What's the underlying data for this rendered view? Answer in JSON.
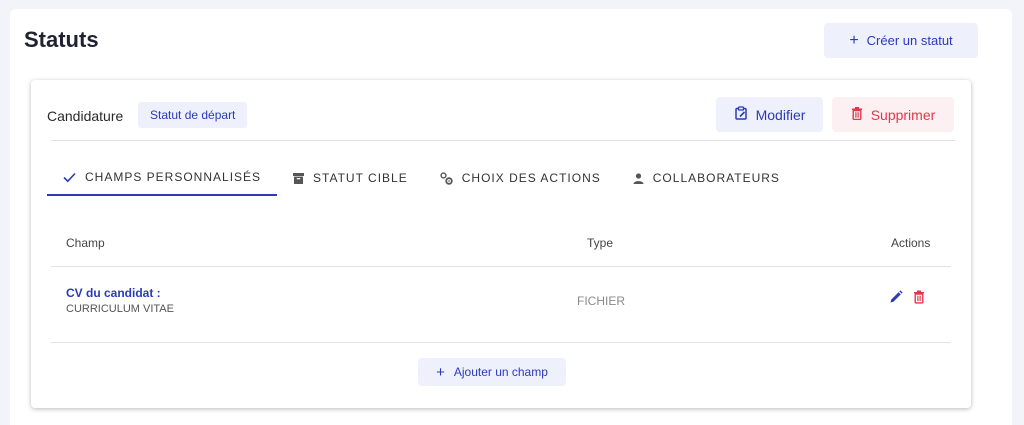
{
  "header": {
    "title": "Statuts",
    "create_label": "Créer un statut"
  },
  "status_card": {
    "name": "Candidature",
    "badge": "Statut de départ",
    "edit_label": "Modifier",
    "delete_label": "Supprimer",
    "tabs": [
      {
        "label": "CHAMPS PERSONNALISÉS",
        "icon": "check-icon",
        "active": true
      },
      {
        "label": "STATUT CIBLE",
        "icon": "archive-icon",
        "active": false
      },
      {
        "label": "CHOIX DES ACTIONS",
        "icon": "gears-icon",
        "active": false
      },
      {
        "label": "COLLABORATEURS",
        "icon": "person-icon",
        "active": false
      }
    ],
    "table": {
      "columns": [
        "Champ",
        "Type",
        "Actions"
      ],
      "rows": [
        {
          "title": "CV du candidat :",
          "subtitle": "CURRICULUM VITAE",
          "type": "FICHIER"
        }
      ]
    },
    "add_field_label": "Ajouter un champ"
  },
  "colors": {
    "accent": "#2b3bb5",
    "danger": "#e2374c",
    "accent_bg": "#eef0fb",
    "danger_bg": "#fdf0f2"
  }
}
